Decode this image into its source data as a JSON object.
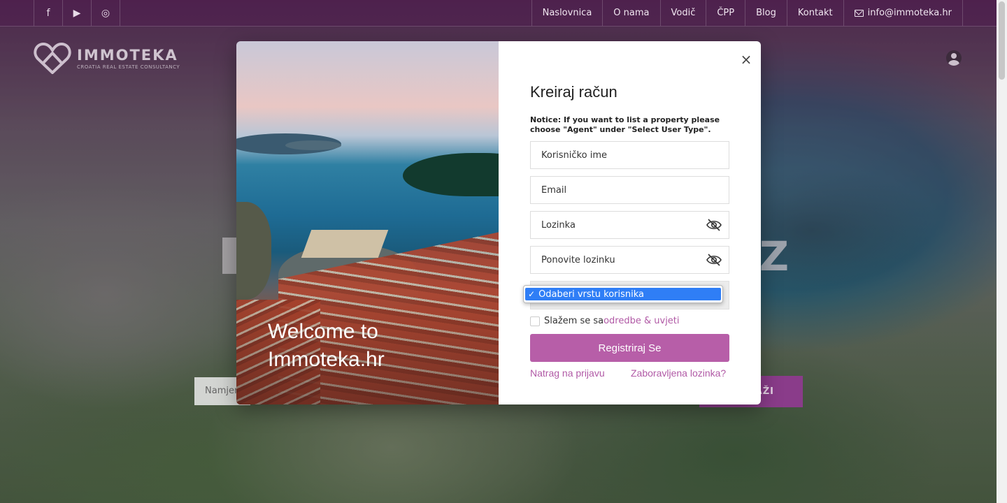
{
  "topbar": {
    "social": [
      {
        "icon": "facebook-icon",
        "glyph": "f"
      },
      {
        "icon": "youtube-icon",
        "glyph": "▶"
      },
      {
        "icon": "instagram-icon",
        "glyph": "◎"
      }
    ],
    "nav": [
      {
        "label": "Naslovnica"
      },
      {
        "label": "O nama"
      },
      {
        "label": "Vodič"
      },
      {
        "label": "ČPP"
      },
      {
        "label": "Blog"
      },
      {
        "label": "Kontakt"
      }
    ],
    "email": "info@immoteka.hr"
  },
  "logo": {
    "name": "IMMOTEKA",
    "tagline": "CROATIA REAL ESTATE CONSULTANCY"
  },
  "hero": {
    "search_placeholder": "Namjen",
    "search_button": "AŽI"
  },
  "modal": {
    "welcome": "Welcome to Immoteka.hr",
    "close": "×",
    "title": "Kreiraj račun",
    "notice": "Notice: If you want to list a property please choose \"Agent\" under \"Select User Type\".",
    "fields": {
      "username_placeholder": "Korisničko ime",
      "email_placeholder": "Email",
      "password_placeholder": "Lozinka",
      "repeat_password_placeholder": "Ponovite lozinku"
    },
    "user_type": {
      "selected": "Odaberi vrstu korisnika",
      "check": "✓"
    },
    "terms": {
      "prefix": "Slažem se sa",
      "link": "odredbe & uvjeti"
    },
    "register_button": "Registriraj Se",
    "back_to_login": "Natrag na prijavu",
    "forgot_password": "Zaboravljena lozinka?"
  },
  "colors": {
    "accent": "#b75ea8",
    "link": "#b15aa6",
    "select_highlight": "#2f7ef6"
  }
}
